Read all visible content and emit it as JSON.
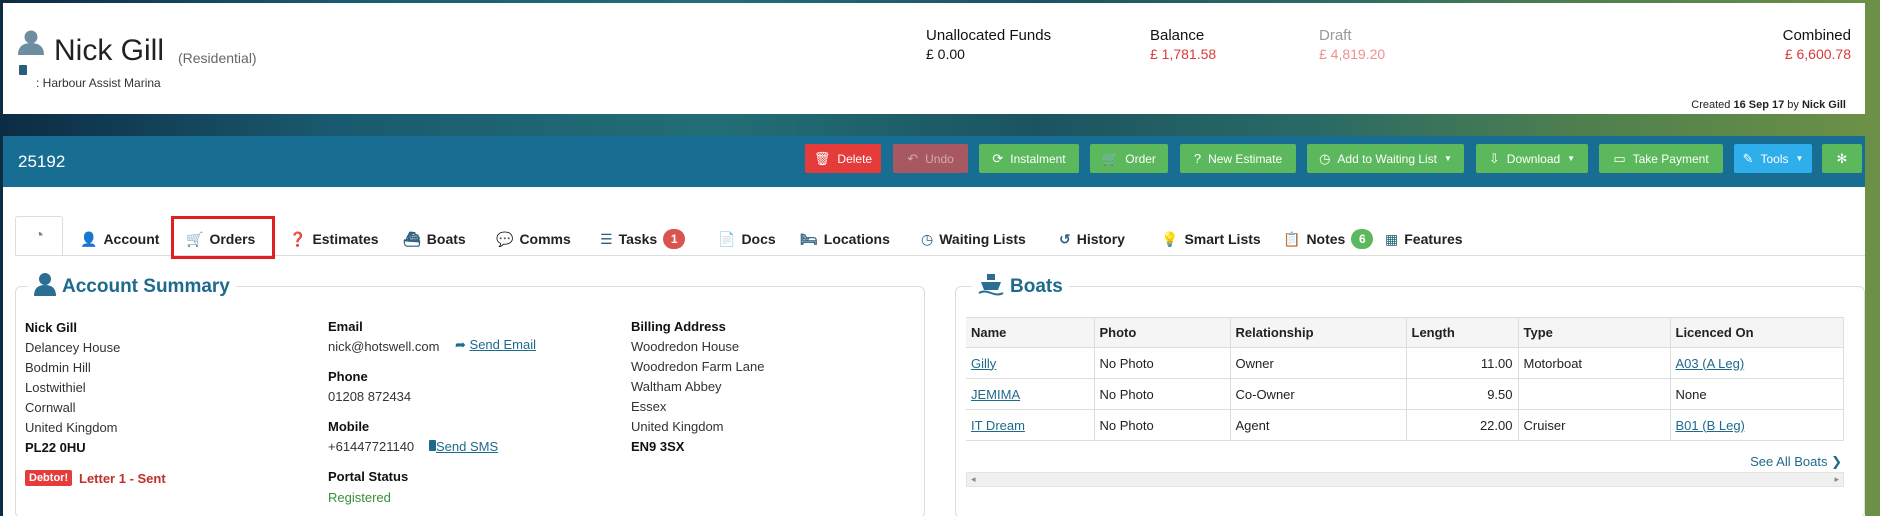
{
  "header": {
    "name": "Nick Gill",
    "customer_type": "(Residential)",
    "marina": ": Harbour Assist Marina",
    "funds": [
      {
        "label": "Unallocated Funds",
        "value": "£ 0.00"
      },
      {
        "label": "Balance",
        "value": "£ 1,781.58"
      },
      {
        "label": "Draft",
        "value": "£ 4,819.20"
      },
      {
        "label": "Combined",
        "value": "£ 6,600.78"
      }
    ],
    "created_prefix": "Created",
    "created_date": "16 Sep 17",
    "created_by_prefix": "by",
    "created_by": "Nick Gill"
  },
  "toolbar": {
    "account_number": "25192",
    "buttons": [
      {
        "label": "Delete",
        "icon": "trash-icon"
      },
      {
        "label": "Undo",
        "icon": "undo-icon"
      },
      {
        "label": "Instalment",
        "icon": "refresh-icon"
      },
      {
        "label": "Order",
        "icon": "cart-icon"
      },
      {
        "label": "New Estimate",
        "icon": "question-icon"
      },
      {
        "label": "Add to Waiting List",
        "icon": "clock-icon"
      },
      {
        "label": "Download",
        "icon": "download-icon"
      },
      {
        "label": "Take Payment",
        "icon": "money-icon"
      },
      {
        "label": "Tools",
        "icon": "magic-wand-icon"
      },
      {
        "label": "",
        "icon": "gear-icon"
      }
    ]
  },
  "tabs": [
    {
      "label": "",
      "icon": "dashboard-icon"
    },
    {
      "label": "Account",
      "icon": "user-icon"
    },
    {
      "label": "Orders",
      "icon": "cart-icon"
    },
    {
      "label": "Estimates",
      "icon": "question-icon"
    },
    {
      "label": "Boats",
      "icon": "boat-icon"
    },
    {
      "label": "Comms",
      "icon": "comments-icon"
    },
    {
      "label": "Tasks",
      "icon": "tasks-icon",
      "badge": "1"
    },
    {
      "label": "Docs",
      "icon": "file-icon"
    },
    {
      "label": "Locations",
      "icon": "bed-icon"
    },
    {
      "label": "Waiting Lists",
      "icon": "clock-icon"
    },
    {
      "label": "History",
      "icon": "history-icon"
    },
    {
      "label": "Smart Lists",
      "icon": "lightbulb-icon"
    },
    {
      "label": "Notes",
      "icon": "note-icon",
      "badge": "6"
    },
    {
      "label": "Features",
      "icon": "grid-icon"
    }
  ],
  "account_summary": {
    "title": "Account Summary",
    "address_name": "Nick Gill",
    "address_lines": [
      "Delancey House",
      "Bodmin Hill",
      "Lostwithiel",
      "Cornwall",
      "United Kingdom"
    ],
    "postcode": "PL22 0HU",
    "debtor_badge": "Debtor!",
    "letter_status": "Letter 1 - Sent",
    "email_label": "Email",
    "email": "nick@hotswell.com",
    "send_email": "Send Email",
    "phone_label": "Phone",
    "phone": "01208 872434",
    "mobile_label": "Mobile",
    "mobile": "+61447721140",
    "send_sms": "Send SMS",
    "portal_label": "Portal Status",
    "portal_status": "Registered",
    "billing_label": "Billing Address",
    "billing_lines": [
      "Woodredon House",
      "Woodredon Farm Lane",
      "Waltham Abbey",
      "Essex",
      "United Kingdom"
    ],
    "billing_postcode": "EN9 3SX"
  },
  "boats": {
    "title": "Boats",
    "columns": [
      "Name",
      "Photo",
      "Relationship",
      "Length",
      "Type",
      "Licenced On"
    ],
    "rows": [
      {
        "name": "Gilly",
        "photo": "No Photo",
        "relationship": "Owner",
        "length": "11.00",
        "type": "Motorboat",
        "licenced": "A03 (A Leg)"
      },
      {
        "name": "JEMIMA",
        "photo": "No Photo",
        "relationship": "Co-Owner",
        "length": "9.50",
        "type": "",
        "licenced": "None"
      },
      {
        "name": "IT Dream",
        "photo": "No Photo",
        "relationship": "Agent",
        "length": "22.00",
        "type": "Cruiser",
        "licenced": "B01 (B Leg)"
      }
    ],
    "see_all": "See All Boats"
  },
  "colors": {
    "brand_blue": "#176e92",
    "success": "#5cb85c",
    "danger": "#e53b3b",
    "info": "#2eaeea",
    "link": "#1e6a8d"
  }
}
